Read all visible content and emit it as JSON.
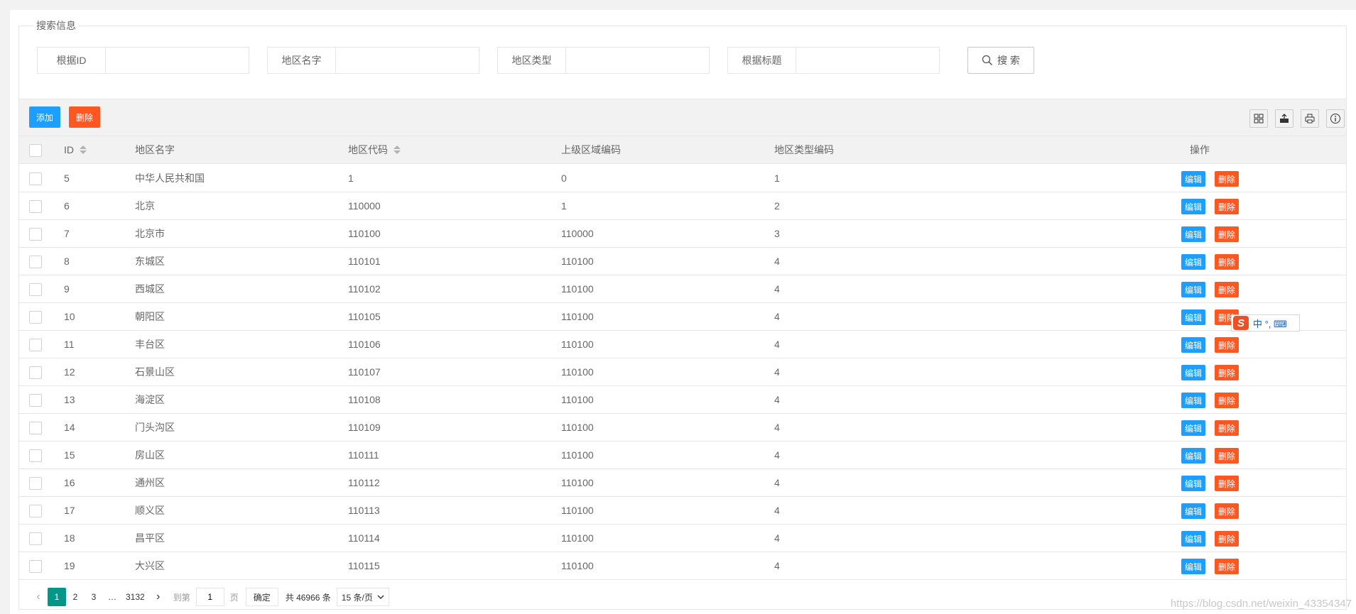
{
  "search": {
    "legend": "搜索信息",
    "fields": [
      {
        "label": "根据ID",
        "value": ""
      },
      {
        "label": "地区名字",
        "value": ""
      },
      {
        "label": "地区类型",
        "value": ""
      },
      {
        "label": "根据标题",
        "value": ""
      }
    ],
    "button_label": "搜 索"
  },
  "toolbar": {
    "add_label": "添加",
    "delete_label": "删除",
    "icons": [
      "columns-icon",
      "export-icon",
      "print-icon",
      "info-icon"
    ]
  },
  "table": {
    "headers": {
      "id": "ID",
      "name": "地区名字",
      "code": "地区代码",
      "parent": "上级区域编码",
      "type": "地区类型编码",
      "ops": "操作"
    },
    "edit_label": "编辑",
    "delete_label": "删除",
    "rows": [
      {
        "id": "5",
        "name": "中华人民共和国",
        "code": "1",
        "parent": "0",
        "type": "1"
      },
      {
        "id": "6",
        "name": "北京",
        "code": "110000",
        "parent": "1",
        "type": "2"
      },
      {
        "id": "7",
        "name": "北京市",
        "code": "110100",
        "parent": "110000",
        "type": "3"
      },
      {
        "id": "8",
        "name": "东城区",
        "code": "110101",
        "parent": "110100",
        "type": "4"
      },
      {
        "id": "9",
        "name": "西城区",
        "code": "110102",
        "parent": "110100",
        "type": "4"
      },
      {
        "id": "10",
        "name": "朝阳区",
        "code": "110105",
        "parent": "110100",
        "type": "4"
      },
      {
        "id": "11",
        "name": "丰台区",
        "code": "110106",
        "parent": "110100",
        "type": "4"
      },
      {
        "id": "12",
        "name": "石景山区",
        "code": "110107",
        "parent": "110100",
        "type": "4"
      },
      {
        "id": "13",
        "name": "海淀区",
        "code": "110108",
        "parent": "110100",
        "type": "4"
      },
      {
        "id": "14",
        "name": "门头沟区",
        "code": "110109",
        "parent": "110100",
        "type": "4"
      },
      {
        "id": "15",
        "name": "房山区",
        "code": "110111",
        "parent": "110100",
        "type": "4"
      },
      {
        "id": "16",
        "name": "通州区",
        "code": "110112",
        "parent": "110100",
        "type": "4"
      },
      {
        "id": "17",
        "name": "顺义区",
        "code": "110113",
        "parent": "110100",
        "type": "4"
      },
      {
        "id": "18",
        "name": "昌平区",
        "code": "110114",
        "parent": "110100",
        "type": "4"
      },
      {
        "id": "19",
        "name": "大兴区",
        "code": "110115",
        "parent": "110100",
        "type": "4"
      }
    ]
  },
  "pager": {
    "prev": "‹",
    "pages": [
      "1",
      "2",
      "3"
    ],
    "ellipsis": "…",
    "last": "3132",
    "next": "›",
    "goto_label": "到第",
    "goto_value": "1",
    "page_unit": "页",
    "confirm_label": "确定",
    "total_label": "共 46966 条",
    "page_size": "15 条/页"
  },
  "ime": {
    "logo": "S",
    "text": "中 °, ⌨"
  },
  "watermark": "https://blog.csdn.net/weixin_43354347",
  "colors": {
    "primary": "#1e9fff",
    "danger": "#ff5722",
    "current_page": "#009688"
  }
}
